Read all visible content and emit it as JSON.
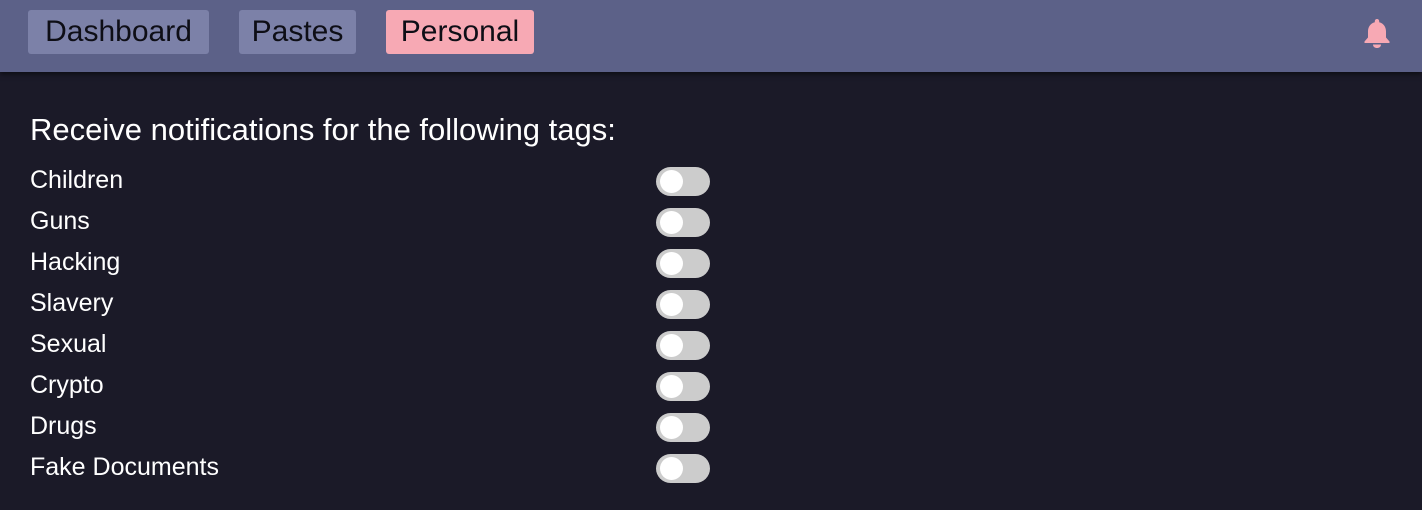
{
  "nav": {
    "items": [
      {
        "label": "Dashboard"
      },
      {
        "label": "Pastes"
      },
      {
        "label": "Personal",
        "active": true
      }
    ],
    "bell_icon": "bell-icon"
  },
  "colors": {
    "topbar": "#5c6188",
    "nav_button": "#7c81a8",
    "active_accent": "#f7a9b4",
    "background": "#1b1a28",
    "toggle_off": "#cccccc"
  },
  "notifications": {
    "heading": "Receive notifications for the following tags:",
    "tags": [
      {
        "label": "Children",
        "enabled": false
      },
      {
        "label": "Guns",
        "enabled": false
      },
      {
        "label": "Hacking",
        "enabled": false
      },
      {
        "label": "Slavery",
        "enabled": false
      },
      {
        "label": "Sexual",
        "enabled": false
      },
      {
        "label": "Crypto",
        "enabled": false
      },
      {
        "label": "Drugs",
        "enabled": false
      },
      {
        "label": "Fake Documents",
        "enabled": false
      }
    ]
  }
}
